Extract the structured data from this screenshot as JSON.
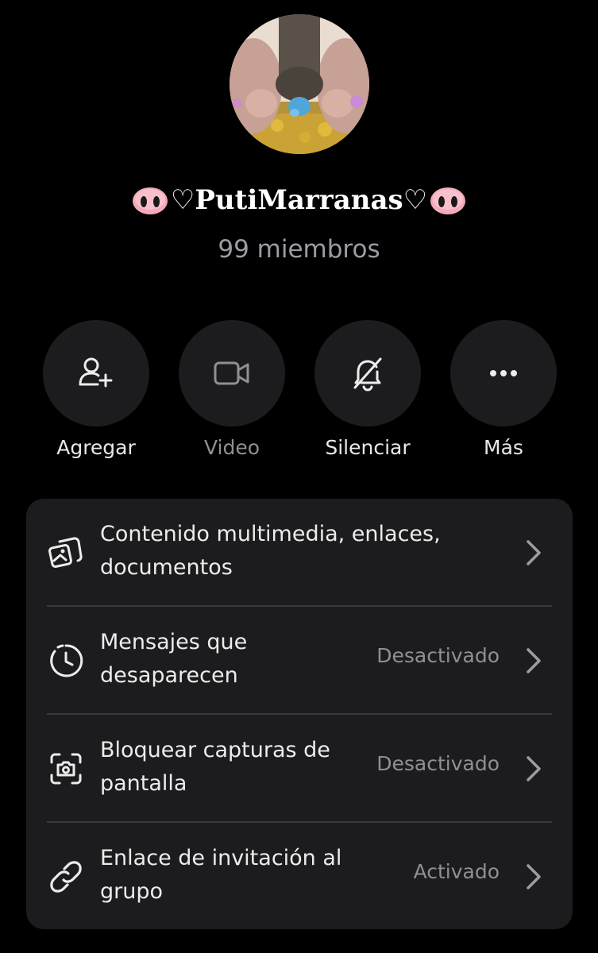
{
  "group": {
    "name": "♡PutiMarranas♡",
    "members": "99 miembros"
  },
  "actions": [
    {
      "label": "Agregar",
      "icon": "add-user-icon",
      "enabled": true
    },
    {
      "label": "Video",
      "icon": "video-camera-icon",
      "enabled": false
    },
    {
      "label": "Silenciar",
      "icon": "bell-off-icon",
      "enabled": true
    },
    {
      "label": "Más",
      "icon": "more-dots-icon",
      "enabled": true
    }
  ],
  "settings": [
    {
      "title": "Contenido multimedia, enlaces, documentos",
      "value": "",
      "icon": "media-gallery-icon"
    },
    {
      "title": "Mensajes que desaparecen",
      "value": "Desactivado",
      "icon": "timer-clock-icon"
    },
    {
      "title": "Bloquear capturas de pantalla",
      "value": "Desactivado",
      "icon": "screenshot-camera-icon"
    },
    {
      "title": "Enlace de invitación al grupo",
      "value": "Activado",
      "icon": "link-icon"
    }
  ],
  "colors": {
    "background": "#000000",
    "card": "#1c1c1e",
    "button": "#1c1c1e",
    "text_primary": "#ececec",
    "text_secondary": "#8d9096",
    "divider": "#3a3a3c"
  }
}
